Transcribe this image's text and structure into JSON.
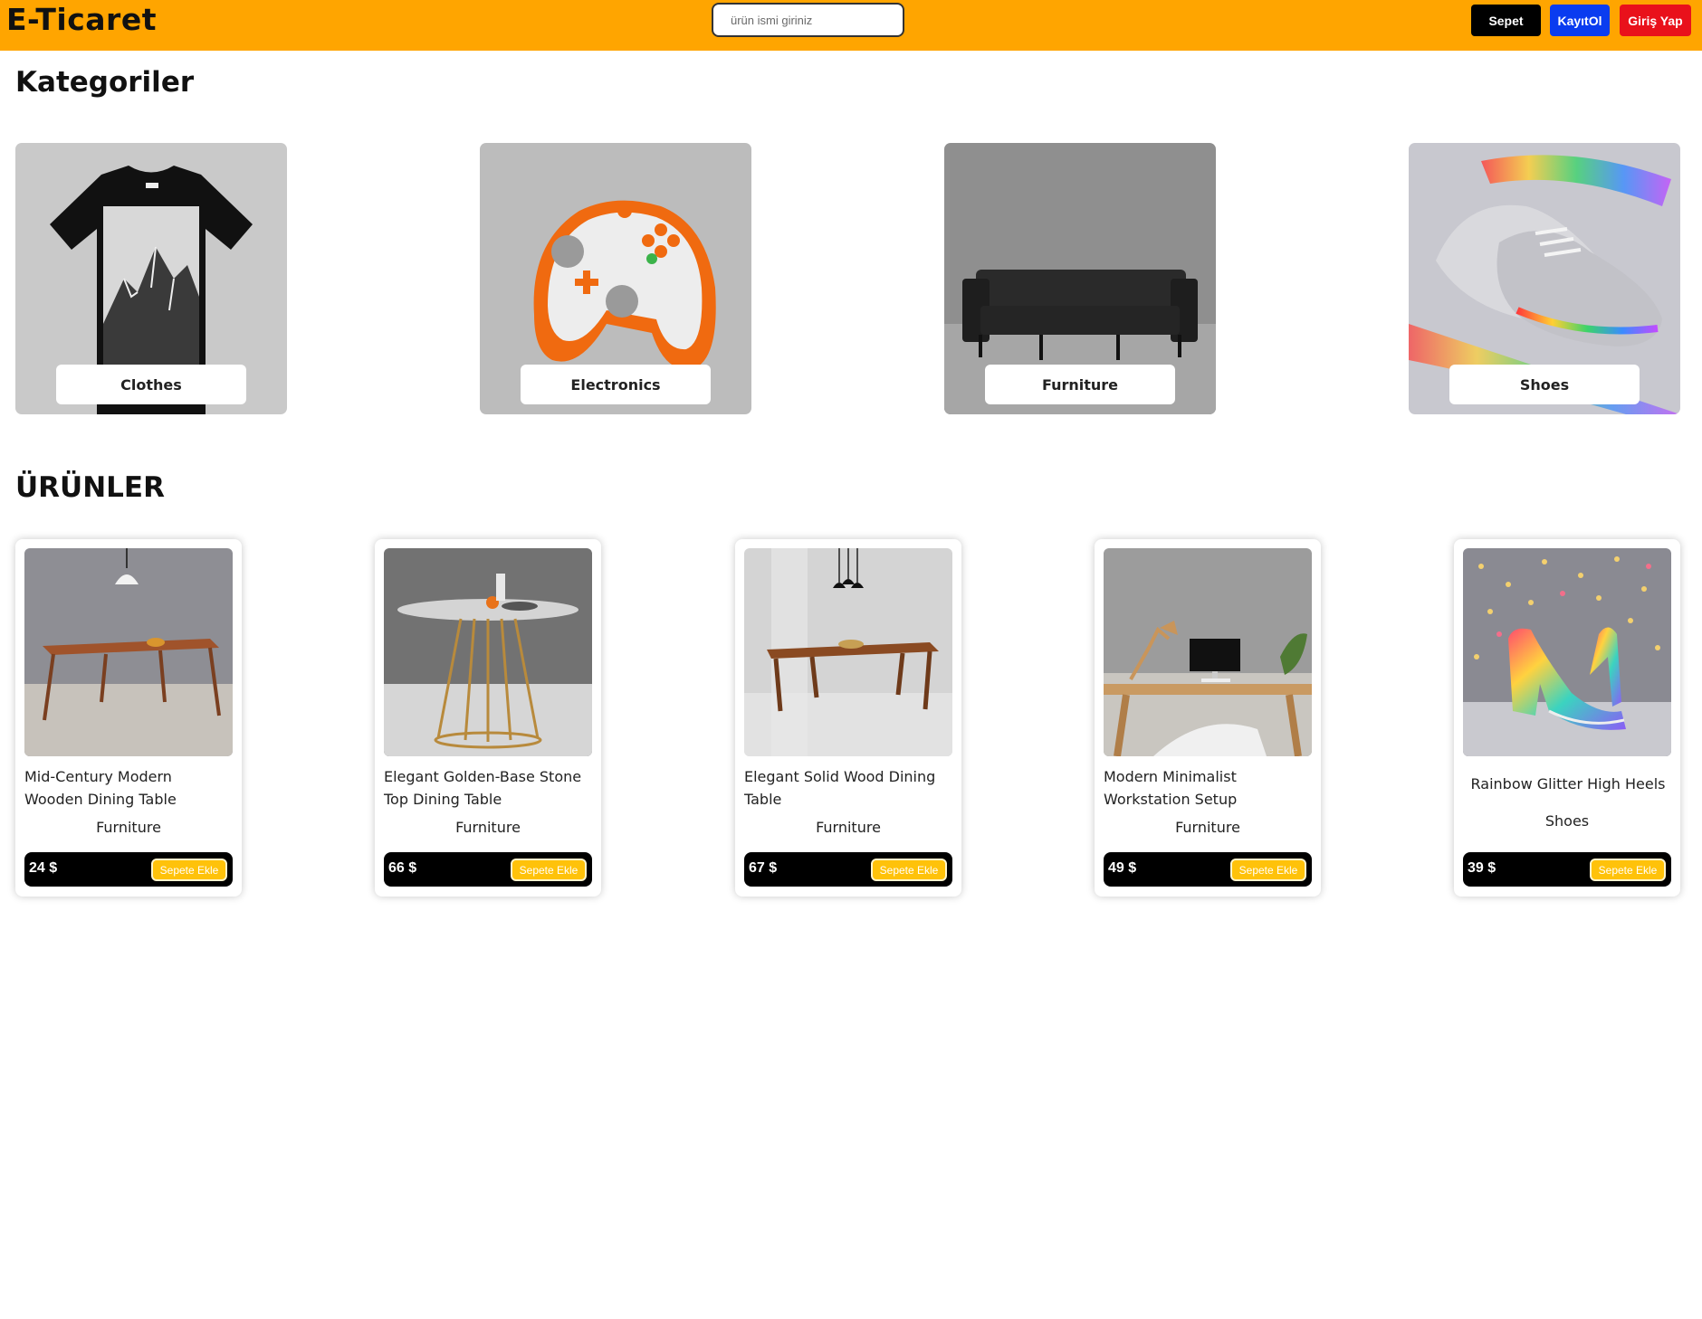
{
  "header": {
    "logo": "E-Ticaret",
    "search_placeholder": "ürün ismi giriniz",
    "cart_label": "Sepet",
    "register_label": "KayıtOl",
    "login_label": "Giriş Yap",
    "colors": {
      "bar": "#ffa500",
      "cart": "#000000",
      "register": "#0a3cf0",
      "login": "#e9111b"
    }
  },
  "categories": {
    "title": "Kategoriler",
    "items": [
      {
        "label": "Clothes",
        "image": "black-mountain-tshirt"
      },
      {
        "label": "Electronics",
        "image": "orange-game-controller"
      },
      {
        "label": "Furniture",
        "image": "black-leather-sofa"
      },
      {
        "label": "Shoes",
        "image": "silver-rainbow-sneakers"
      }
    ]
  },
  "products": {
    "title": "ÜRÜNLER",
    "add_to_cart_label": "Sepete Ekle",
    "items": [
      {
        "title": "Mid-Century Modern Wooden Dining Table",
        "category": "Furniture",
        "price": "24 $",
        "image": "wooden-dining-table-lamp"
      },
      {
        "title": "Elegant Golden-Base Stone Top Dining Table",
        "category": "Furniture",
        "price": "66 $",
        "image": "round-golden-base-table"
      },
      {
        "title": "Elegant Solid Wood Dining Table",
        "category": "Furniture",
        "price": "67 $",
        "image": "solid-wood-table"
      },
      {
        "title": "Modern Minimalist Workstation Setup",
        "category": "Furniture",
        "price": "49 $",
        "image": "desk-workstation"
      },
      {
        "title": "Rainbow Glitter High Heels",
        "category": "Shoes",
        "price": "39 $",
        "image": "rainbow-high-heels"
      }
    ]
  }
}
